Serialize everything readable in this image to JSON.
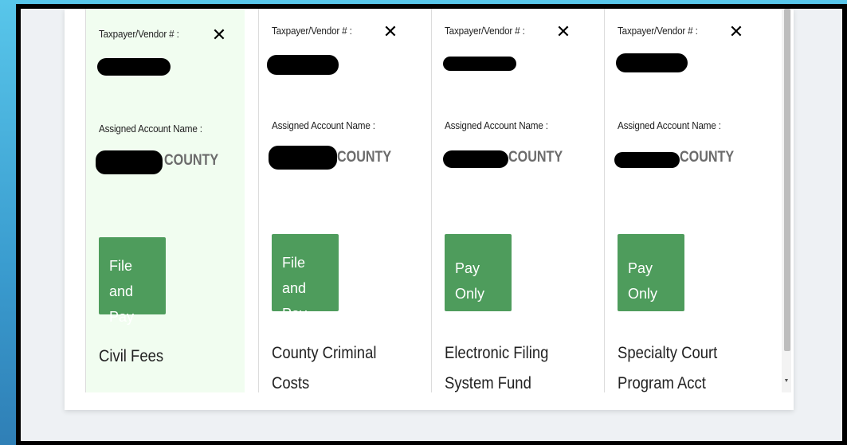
{
  "labels": {
    "taxpayer_vendor": "Taxpayer/Vendor # :",
    "assigned_account": "Assigned Account Name :"
  },
  "cards": [
    {
      "selected": true,
      "account_suffix": "COUNTY",
      "action_label": "File and Pay",
      "fee_name": "Civil Fees"
    },
    {
      "selected": false,
      "account_suffix": "COUNTY",
      "action_label": "File and Pay",
      "fee_name": "County Criminal Costs"
    },
    {
      "selected": false,
      "account_suffix": "COUNTY",
      "action_label": "Pay Only",
      "fee_name": "Electronic Filing System Fund"
    },
    {
      "selected": false,
      "account_suffix": "COUNTY",
      "action_label": "Pay Only",
      "fee_name": "Specialty Court Program Acct"
    }
  ],
  "icons": {
    "remove": "close-icon",
    "scroll_down": "chevron-down-icon"
  },
  "colors": {
    "action_button": "#4e9c5c",
    "selected_card_bg": "#f1fdf0",
    "account_text": "#6b6b6b"
  }
}
